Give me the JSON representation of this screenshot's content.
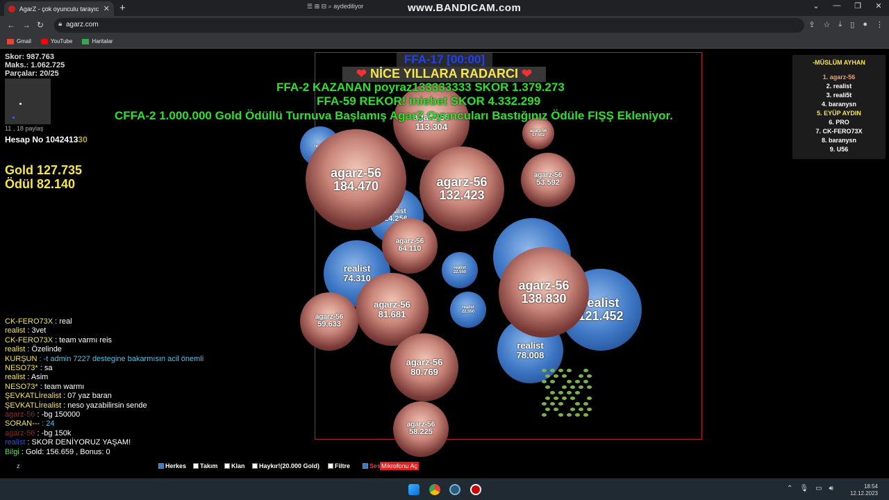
{
  "browser": {
    "tab_title": "AgarZ - çok oyunculu tarayıcı oy",
    "url": "agarz.com",
    "bookmarks": [
      "Gmail",
      "YouTube",
      "Haritalar"
    ],
    "overlay_watermark": "www.BANDICAM.com",
    "recorder_tools": "aydediliyor"
  },
  "hud": {
    "score": "Skor: 987.763",
    "max": "Maks.: 1.062.725",
    "parts": "Parçalar: 20/25",
    "share": "11 , 18 paylaş",
    "account": "Hesap No 1042413",
    "account_suffix": "30",
    "gold": "Gold 127.735",
    "reward": "Ödül 82.140"
  },
  "banner": {
    "ffa": "FFA-17 [00:00]",
    "message": "NİCE YILLARA RADARCI",
    "line1": "FFA-2 KAZANAN poyraz133333333 SKOR 1.379.273",
    "line2": "FFA-59 REKOR! iniebet SKOR 4.332.299",
    "line3": "CFFA-2 1.000.000 Gold Ödüllü Turnuva Başlamış AgarZ Oyuncuları Bastığınız Ödüle FIŞŞ Ekleniyor."
  },
  "leaderboard": {
    "title": "-MÜSLÜM AYHAN",
    "rows": [
      {
        "text": "1. agarz-56",
        "color": "#f0a070"
      },
      {
        "text": "2. realist",
        "color": "#ffffff"
      },
      {
        "text": "3. reali5t",
        "color": "#ffffff"
      },
      {
        "text": "4. baranysn",
        "color": "#ffffff"
      },
      {
        "text": "5. EYÜP AYDIN",
        "color": "#f6e64a"
      },
      {
        "text": "6. PRO",
        "color": "#ffffff"
      },
      {
        "text": "7. CK-FERO73X",
        "color": "#ffffff"
      },
      {
        "text": "8. baranysn",
        "color": "#ffffff"
      },
      {
        "text": "9. U56",
        "color": "#ffffff"
      }
    ]
  },
  "cells": [
    {
      "name": "agarz-56",
      "mass": "184.470",
      "kind": "skin",
      "size": "big"
    },
    {
      "name": "agarz-56",
      "mass": "132.423",
      "kind": "skin",
      "size": "big"
    },
    {
      "name": "agarz-56",
      "mass": "138.830",
      "kind": "skin",
      "size": "big"
    },
    {
      "name": "agarz-56",
      "mass": "113.304",
      "kind": "skin",
      "size": "mid"
    },
    {
      "name": "agarz-56",
      "mass": "53.592",
      "kind": "skin",
      "size": "small"
    },
    {
      "name": "agarz-56",
      "mass": "17.502",
      "kind": "skin",
      "size": "tiny"
    },
    {
      "name": "agarz-56",
      "mass": "64.110",
      "kind": "skin",
      "size": "small"
    },
    {
      "name": "agarz-56",
      "mass": "81.681",
      "kind": "skin",
      "size": "mid"
    },
    {
      "name": "agarz-56",
      "mass": "59.633",
      "kind": "skin",
      "size": "small"
    },
    {
      "name": "agarz-56",
      "mass": "80.769",
      "kind": "skin",
      "size": "mid"
    },
    {
      "name": "agarz-56",
      "mass": "58.225",
      "kind": "skin",
      "size": "small"
    },
    {
      "name": "realist",
      "mass": "74.310",
      "kind": "blue",
      "size": "mid"
    },
    {
      "name": "realist",
      "mass": "121.452",
      "kind": "blue",
      "size": "big"
    },
    {
      "name": "realist",
      "mass": "78.008",
      "kind": "blue",
      "size": "mid"
    },
    {
      "name": "realist",
      "mass": "24.256",
      "kind": "blue",
      "size": "small"
    },
    {
      "name": "realist",
      "mass": "22.550",
      "kind": "blue",
      "size": "tiny"
    },
    {
      "name": "realist",
      "mass": "22.550",
      "kind": "blue",
      "size": "tiny"
    },
    {
      "name": "realist",
      "mass": "",
      "kind": "blue",
      "size": "mid"
    },
    {
      "name": "realist",
      "mass": "",
      "kind": "blue",
      "size": "tiny"
    }
  ],
  "chat": [
    {
      "user": "CK-FERO73X",
      "ucolor": "#f6e64a",
      "msg": " : real",
      "mcolor": "#ffffff"
    },
    {
      "user": "realist",
      "ucolor": "#f6e64a",
      "msg": " : 3vet",
      "mcolor": "#ffffff"
    },
    {
      "user": "CK-FERO73X",
      "ucolor": "#f6e64a",
      "msg": " : team varmı reis",
      "mcolor": "#ffffff"
    },
    {
      "user": "realist",
      "ucolor": "#f6e64a",
      "msg": " : Özelinde",
      "mcolor": "#ffffff"
    },
    {
      "user": "KURŞUN",
      "ucolor": "#f6e64a",
      "msg": " : -t admin 7227 destegine bakarmısın acil önemli",
      "mcolor": "#4ec3ea"
    },
    {
      "user": "NESO73*",
      "ucolor": "#f6e64a",
      "msg": " : sa",
      "mcolor": "#ffffff"
    },
    {
      "user": "realist",
      "ucolor": "#f6e64a",
      "msg": " : Asim",
      "mcolor": "#ffffff"
    },
    {
      "user": "NESO73*",
      "ucolor": "#f6e64a",
      "msg": " : team warmı",
      "mcolor": "#ffffff"
    },
    {
      "user": "ŞEVKATLİrealist",
      "ucolor": "#f6e64a",
      "msg": " : 07 yaz baran",
      "mcolor": "#ffffff"
    },
    {
      "user": "ŞEVKATLİrealist",
      "ucolor": "#f6e64a",
      "msg": " : neso yazabilirsin sende",
      "mcolor": "#ffffff"
    },
    {
      "user": "agarz-56",
      "ucolor": "#8a2a2a",
      "msg": " : -bg 150000",
      "mcolor": "#ffffff"
    },
    {
      "user": "SORAN---",
      "ucolor": "#f6e64a",
      "msg": " : 24",
      "mcolor": "#4ec3ea"
    },
    {
      "user": "agarz-56",
      "ucolor": "#8a2a2a",
      "msg": " : -bg 150k",
      "mcolor": "#ffffff"
    },
    {
      "user": "realist",
      "ucolor": "#3050c0",
      "msg": " : SKOR DENİYORUZ YAŞAM!",
      "mcolor": "#ffffff"
    },
    {
      "user": "Bilgi",
      "ucolor": "#4ee04e",
      "msg": " : Gold: 156.659 , Bonus: 0",
      "mcolor": "#ffffff"
    }
  ],
  "controls": {
    "z": "z",
    "all": "Herkes",
    "team": "Takım",
    "clan": "Klan",
    "shout": "Haykır!(20.000 Gold)",
    "filter": "Filtre",
    "sound": "Ses",
    "mic": "Mikrofonu Aç"
  },
  "taskbar": {
    "time": "18:54",
    "date": "12.12.2023"
  }
}
